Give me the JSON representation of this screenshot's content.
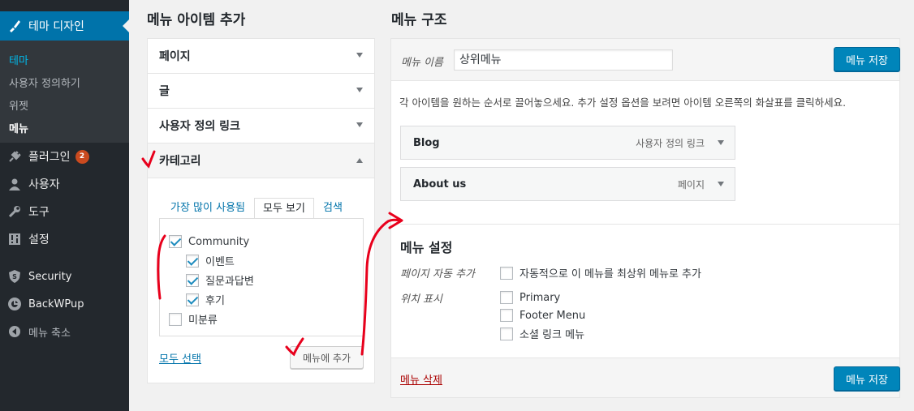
{
  "sidebar": {
    "current": "테마 디자인",
    "submenu": [
      "테마",
      "사용자 정의하기",
      "위젯",
      "메뉴"
    ],
    "items": [
      {
        "label": "플러그인",
        "badge": "2",
        "icon": "plugin-icon"
      },
      {
        "label": "사용자",
        "icon": "user-icon"
      },
      {
        "label": "도구",
        "icon": "wrench-icon"
      },
      {
        "label": "설정",
        "icon": "settings-icon"
      },
      {
        "label": "Security",
        "icon": "shield-icon"
      },
      {
        "label": "BackWPup",
        "icon": "backwpup-icon"
      },
      {
        "label": "메뉴 축소",
        "icon": "collapse-icon"
      }
    ]
  },
  "left": {
    "title": "메뉴 아이템 추가",
    "sections": [
      "페이지",
      "글",
      "사용자 정의 링크",
      "카테고리"
    ],
    "tabs": [
      "가장 많이 사용됨",
      "모두 보기",
      "검색"
    ],
    "categories": [
      {
        "label": "Community",
        "checked": true
      },
      {
        "label": "이벤트",
        "checked": true
      },
      {
        "label": "질문과답변",
        "checked": true
      },
      {
        "label": "후기",
        "checked": true
      },
      {
        "label": "미분류",
        "checked": false
      }
    ],
    "select_all": "모두 선택",
    "add_button": "메뉴에 추가"
  },
  "right": {
    "title": "메뉴 구조",
    "name_label": "메뉴 이름",
    "name_value": "상위메뉴",
    "save_button": "메뉴 저장",
    "instructions": "각 아이템을 원하는 순서로 끌어놓으세요. 추가 설정 옵션을 보려면 아이템 오른쪽의 화살표를 클릭하세요.",
    "items": [
      {
        "title": "Blog",
        "type": "사용자 정의 링크"
      },
      {
        "title": "About us",
        "type": "페이지"
      }
    ],
    "settings_title": "메뉴 설정",
    "auto_add_label": "페이지 자동 추가",
    "auto_add_option": "자동적으로 이 메뉴를 최상위 메뉴로 추가",
    "location_label": "위치 표시",
    "locations": [
      "Primary",
      "Footer Menu",
      "소셜 링크 메뉴"
    ],
    "delete_link": "메뉴 삭제"
  },
  "colors": {
    "accent": "#0073aa",
    "primary_button": "#0085ba",
    "sidebar_bg": "#23282d",
    "annotation": "#e8001c"
  }
}
